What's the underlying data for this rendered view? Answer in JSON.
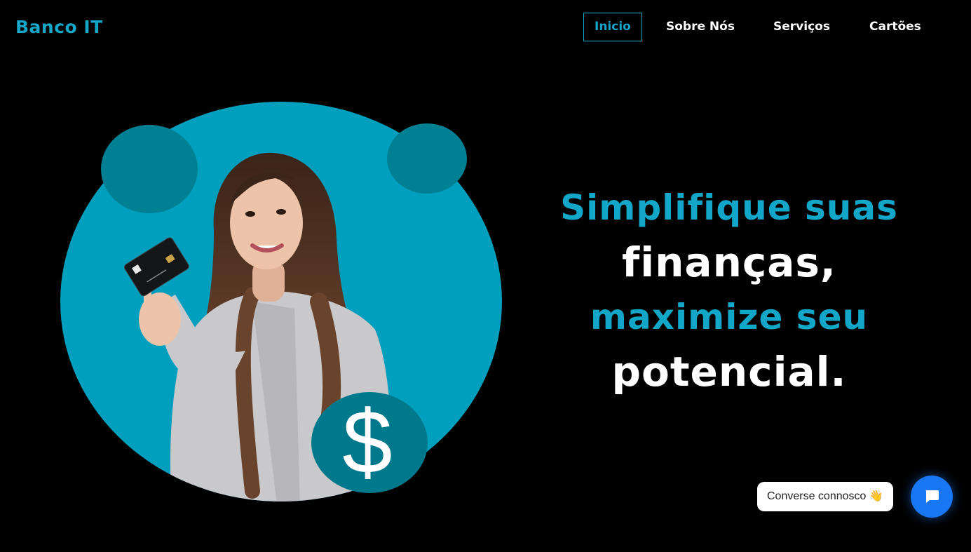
{
  "header": {
    "brand": "Banco IT",
    "nav": [
      {
        "label": "Inicio",
        "active": true
      },
      {
        "label": "Sobre Nós",
        "active": false
      },
      {
        "label": "Serviços",
        "active": false
      },
      {
        "label": "Cartões",
        "active": false
      }
    ]
  },
  "hero": {
    "headline": [
      {
        "text": "Simplifique suas",
        "color": "#12a6c8"
      },
      {
        "text": "finanças,",
        "color": "#ffffff"
      },
      {
        "text": "maximize seu",
        "color": "#12a6c8"
      },
      {
        "text": "potencial.",
        "color": "#ffffff"
      }
    ],
    "illustration": {
      "icons": [
        "dollar-sign-icon",
        "credit-card-icon"
      ],
      "dollar_symbol": "$"
    }
  },
  "chat": {
    "bubble_text": "Converse connosco",
    "bubble_emoji": "👋",
    "button_icon": "chat-icon"
  },
  "colors": {
    "accent": "#12a6c8",
    "circle": "#009fbe",
    "circle_dark": "#017f93",
    "background": "#000000",
    "chat_button": "#1877f2"
  }
}
